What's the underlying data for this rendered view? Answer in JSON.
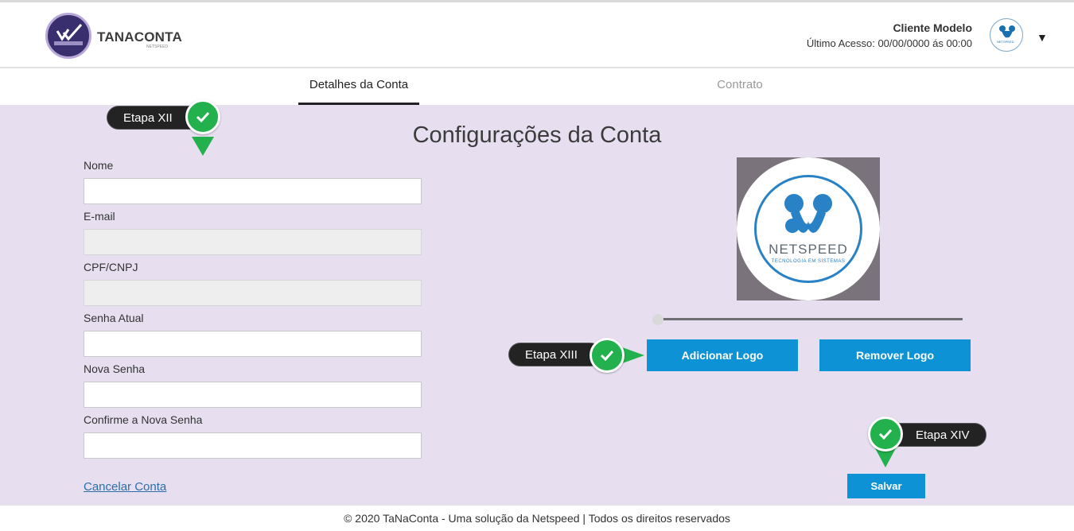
{
  "brand": {
    "name": "TANACONTA",
    "subtitle": "NETSPEED"
  },
  "user": {
    "name": "Cliente Modelo",
    "last_access": "Último Acesso: 00/00/0000 ás 00:00",
    "avatar_text": "NETSPEED"
  },
  "tabs": [
    {
      "label": "Detalhes da Conta",
      "active": true
    },
    {
      "label": "Contrato",
      "active": false
    }
  ],
  "page": {
    "title": "Configurações da Conta"
  },
  "form": {
    "fields": [
      {
        "label": "Nome",
        "value": "",
        "disabled": false
      },
      {
        "label": "E-mail",
        "value": "",
        "disabled": true
      },
      {
        "label": "CPF/CNPJ",
        "value": "",
        "disabled": true
      },
      {
        "label": "Senha Atual",
        "value": "",
        "disabled": false
      },
      {
        "label": "Nova Senha",
        "value": "",
        "disabled": false
      },
      {
        "label": "Confirme a Nova Senha",
        "value": "",
        "disabled": false
      }
    ],
    "cancel_link": "Cancelar Conta"
  },
  "logo_panel": {
    "logo_title": "NETSPEED",
    "logo_subtitle": "TECNOLOGIA EM SISTEMAS",
    "zoom_slider_value": 0,
    "add_label": "Adicionar Logo",
    "remove_label": "Remover Logo",
    "save_label": "Salvar"
  },
  "steps": {
    "step12": "Etapa XII",
    "step13": "Etapa XIII",
    "step14": "Etapa XIV"
  },
  "footer": {
    "text": "© 2020 TaNaConta - Uma solução da Netspeed | Todos os direitos reservados"
  },
  "colors": {
    "accent_blue": "#0e92d6",
    "background_lilac": "#e7deef",
    "check_green": "#22b14c",
    "brand_purple": "#3a2f6e"
  },
  "icons": [
    "tanaconta-logo-icon",
    "netspeed-avatar-icon",
    "caret-down-icon",
    "checkmark-icon"
  ]
}
